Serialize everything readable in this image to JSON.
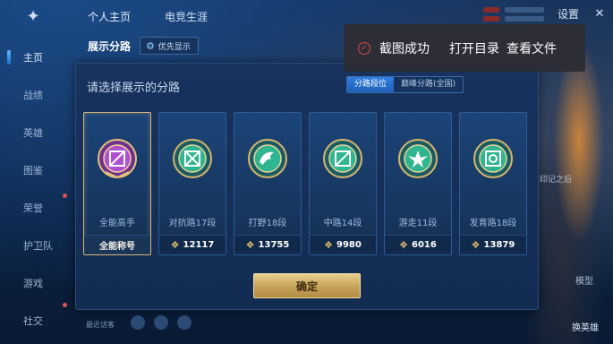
{
  "top_tabs": [
    "个人主页",
    "电竞生涯"
  ],
  "top_right": {
    "settings": "设置"
  },
  "sidebar": [
    {
      "label": "主页",
      "active": true
    },
    {
      "label": "战绩"
    },
    {
      "label": "英雄"
    },
    {
      "label": "图鉴"
    },
    {
      "label": "荣誉"
    },
    {
      "label": "护卫队"
    },
    {
      "label": "游戏"
    },
    {
      "label": "社交"
    }
  ],
  "panel": {
    "title": "展示分路",
    "pref_button": "优先显示",
    "choose_label": "请选择展示的分路",
    "segments": [
      "分路段位",
      "巅峰分路(全国)"
    ],
    "cards": [
      {
        "name": "全能高手",
        "foot": "全能称号",
        "selected": true,
        "color": "#b14fd1"
      },
      {
        "name": "对抗路17段",
        "power": "12117",
        "color": "#2fb58f"
      },
      {
        "name": "打野18段",
        "power": "13755",
        "color": "#2fb58f"
      },
      {
        "name": "中路14段",
        "power": "9980",
        "color": "#2fb58f"
      },
      {
        "name": "游走11段",
        "power": "6016",
        "color": "#2fb58f"
      },
      {
        "name": "发育路18段",
        "power": "13879",
        "color": "#2fb58f"
      }
    ],
    "confirm": "确定"
  },
  "toast": {
    "message": "截图成功",
    "open_folder": "打开目录",
    "view_file": "查看文件"
  },
  "right_side": {
    "text": "印记之后",
    "bottom_btn": "换英雄",
    "mid_btn": "模型"
  },
  "bottom": {
    "recent": "最近访客"
  }
}
